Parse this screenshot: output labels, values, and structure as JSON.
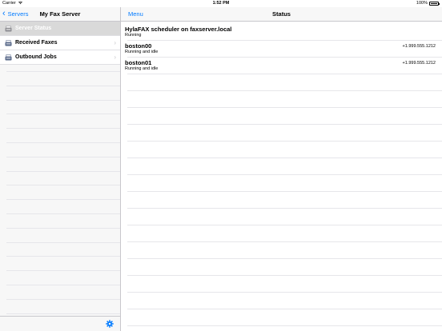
{
  "status_bar": {
    "carrier": "Carrier",
    "time": "1:52 PM",
    "battery": "100%"
  },
  "left": {
    "back_label": "Servers",
    "title": "My Fax Server",
    "items": [
      {
        "label": "Server Status",
        "selected": true
      },
      {
        "label": "Received Faxes",
        "selected": false
      },
      {
        "label": "Outbound Jobs",
        "selected": false
      }
    ]
  },
  "right": {
    "menu_label": "Menu",
    "title": "Status",
    "rows": [
      {
        "name": "HylaFAX scheduler on faxserver.local",
        "state": "Running",
        "phone": ""
      },
      {
        "name": "boston00",
        "state": "Running and idle",
        "phone": "+1.999.555.1212"
      },
      {
        "name": "boston01",
        "state": "Running and idle",
        "phone": "+1.999.555.1212"
      }
    ]
  },
  "colors": {
    "accent": "#007aff",
    "selected_row": "#d9d9d9"
  }
}
